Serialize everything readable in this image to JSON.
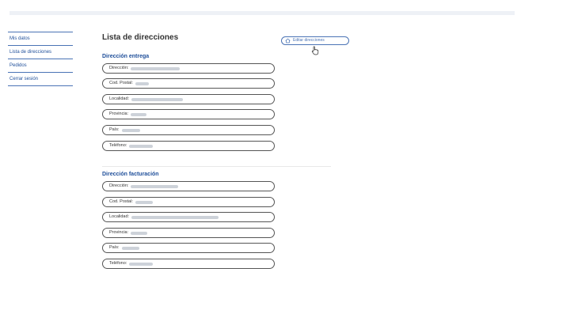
{
  "sidebar": {
    "items": [
      {
        "label": "Mis datos"
      },
      {
        "label": "Lista de direcciones"
      },
      {
        "label": "Pedidos"
      },
      {
        "label": "Cerrar sesión"
      }
    ]
  },
  "main": {
    "title": "Lista de direcciones",
    "edit_button": "Editar direcciones",
    "shipping": {
      "title": "Dirección entrega",
      "fields": [
        {
          "label": "Dirección:"
        },
        {
          "label": "Cod. Postal:"
        },
        {
          "label": "Localidad:"
        },
        {
          "label": "Provincia:"
        },
        {
          "label": "País:"
        },
        {
          "label": "Teléfono:"
        }
      ]
    },
    "billing": {
      "title": "Dirección facturación",
      "fields": [
        {
          "label": "Dirección:"
        },
        {
          "label": "Cod. Postal:"
        },
        {
          "label": "Localidad:"
        },
        {
          "label": "Provincia:"
        },
        {
          "label": "País:"
        },
        {
          "label": "Teléfono:"
        }
      ]
    }
  }
}
